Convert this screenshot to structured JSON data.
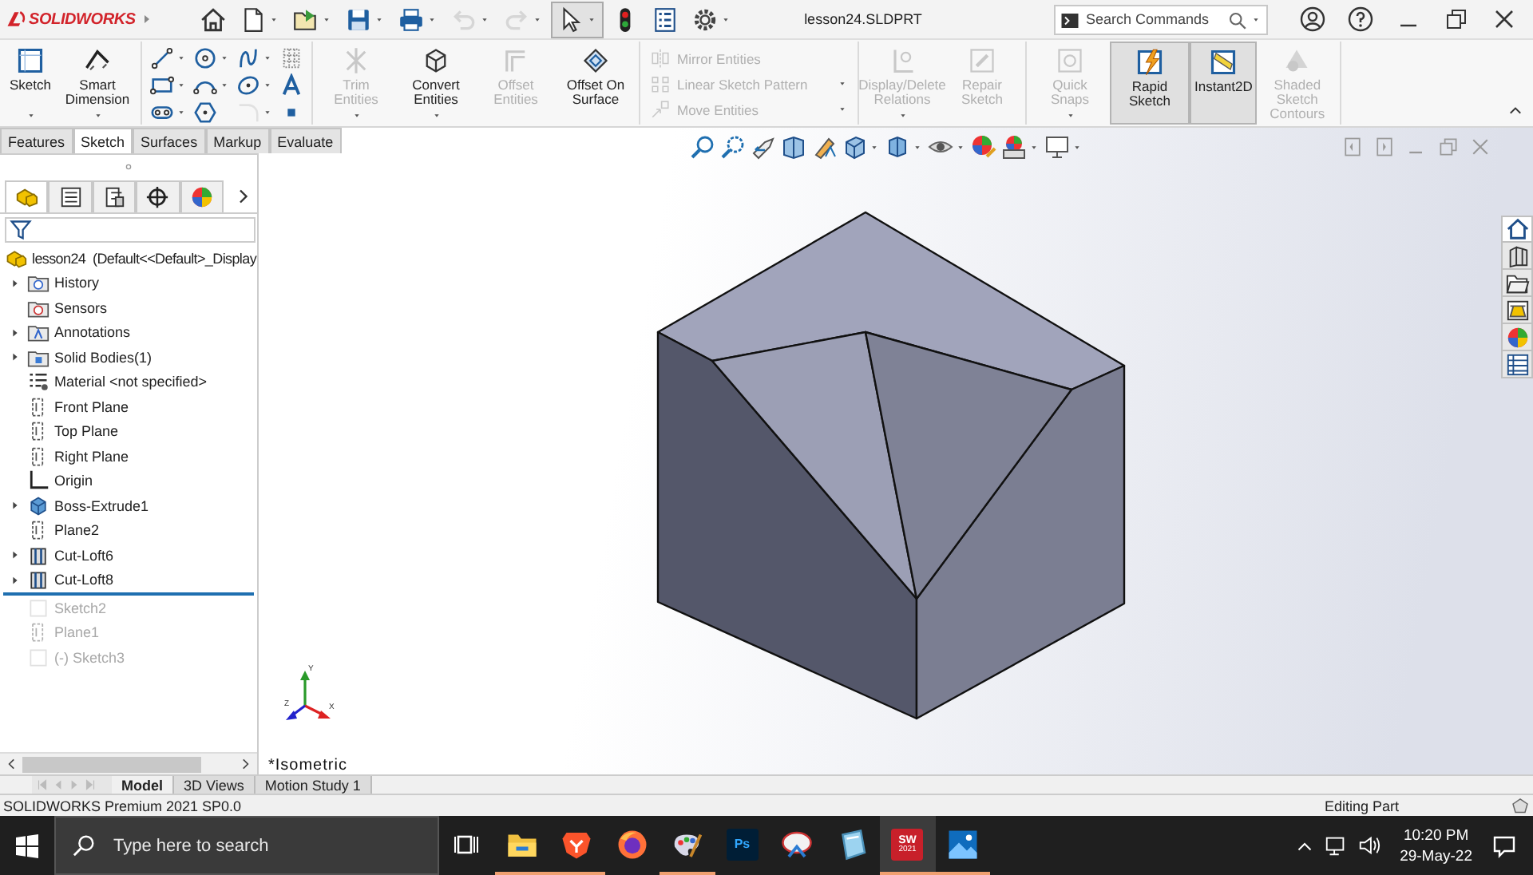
{
  "title_bar": {
    "logo": "SOLIDWORKS",
    "document_title": "lesson24.SLDPRT",
    "search": {
      "placeholder": "Search Commands"
    },
    "quick_access": [
      {
        "kind": "home",
        "dropdown": false,
        "disabled": false,
        "selected": false
      },
      {
        "kind": "new",
        "dropdown": true,
        "disabled": false,
        "selected": false
      },
      {
        "kind": "open",
        "dropdown": true,
        "disabled": false,
        "selected": false
      },
      {
        "kind": "save",
        "dropdown": true,
        "disabled": false,
        "selected": false
      },
      {
        "kind": "print",
        "dropdown": true,
        "disabled": false,
        "selected": false
      },
      {
        "kind": "undo",
        "dropdown": true,
        "disabled": true,
        "selected": false
      },
      {
        "kind": "redo",
        "dropdown": true,
        "disabled": true,
        "selected": false
      },
      {
        "kind": "select",
        "dropdown": true,
        "disabled": false,
        "selected": true
      },
      {
        "kind": "rebuild",
        "dropdown": false,
        "disabled": false,
        "selected": false
      },
      {
        "kind": "properties",
        "dropdown": false,
        "disabled": false,
        "selected": false
      },
      {
        "kind": "options",
        "dropdown": true,
        "disabled": false,
        "selected": false
      }
    ]
  },
  "ribbon": {
    "groups": [
      {
        "kind": "large",
        "tools": [
          {
            "kind": "sketch",
            "label": "Sketch",
            "disabled": false,
            "selected": false,
            "dropdown": true
          },
          {
            "kind": "smart_dimension",
            "label": "Smart Dimension",
            "disabled": false,
            "selected": false,
            "dropdown": true
          }
        ]
      },
      {
        "kind": "grid",
        "tools": [
          {
            "kind": "line",
            "dropdown": true,
            "disabled": false
          },
          {
            "kind": "circle",
            "dropdown": true,
            "disabled": false
          },
          {
            "kind": "spline",
            "dropdown": true,
            "disabled": false
          },
          {
            "kind": "grid_plane",
            "dropdown": false,
            "disabled": false
          },
          {
            "kind": "rectangle",
            "dropdown": true,
            "disabled": false
          },
          {
            "kind": "arc",
            "dropdown": true,
            "disabled": false
          },
          {
            "kind": "ellipse",
            "dropdown": true,
            "disabled": false
          },
          {
            "kind": "text",
            "dropdown": false,
            "disabled": false
          },
          {
            "kind": "slot",
            "dropdown": true,
            "disabled": false
          },
          {
            "kind": "polygon",
            "dropdown": false,
            "disabled": false
          },
          {
            "kind": "fillet",
            "dropdown": true,
            "disabled": true
          },
          {
            "kind": "point",
            "dropdown": false,
            "disabled": false
          }
        ]
      },
      {
        "kind": "large",
        "tools": [
          {
            "kind": "trim",
            "label": "Trim Entities",
            "disabled": true,
            "selected": false,
            "dropdown": true
          },
          {
            "kind": "convert",
            "label": "Convert Entities",
            "disabled": false,
            "selected": false,
            "dropdown": true
          },
          {
            "kind": "offset",
            "label": "Offset Entities",
            "disabled": true,
            "selected": false,
            "dropdown": false
          },
          {
            "kind": "offset_surface",
            "label": "Offset On Surface",
            "disabled": false,
            "selected": false,
            "dropdown": false
          }
        ]
      },
      {
        "kind": "stack",
        "tools": [
          {
            "kind": "mirror",
            "label": "Mirror Entities",
            "disabled": true,
            "dropdown": false
          },
          {
            "kind": "pattern",
            "label": "Linear Sketch Pattern",
            "disabled": true,
            "dropdown": true
          },
          {
            "kind": "move",
            "label": "Move Entities",
            "disabled": true,
            "dropdown": true
          }
        ]
      },
      {
        "kind": "large",
        "tools": [
          {
            "kind": "relations",
            "label": "Display/Delete Relations",
            "disabled": true,
            "selected": false,
            "dropdown": true
          },
          {
            "kind": "repair",
            "label": "Repair Sketch",
            "disabled": true,
            "selected": false,
            "dropdown": false
          }
        ]
      },
      {
        "kind": "large",
        "tools": [
          {
            "kind": "snaps",
            "label": "Quick Snaps",
            "disabled": true,
            "selected": false,
            "dropdown": true
          },
          {
            "kind": "rapid",
            "label": "Rapid Sketch",
            "disabled": false,
            "selected": true,
            "dropdown": false
          },
          {
            "kind": "instant2d",
            "label": "Instant2D",
            "disabled": false,
            "selected": true,
            "dropdown": false
          },
          {
            "kind": "shaded",
            "label": "Shaded Sketch Contours",
            "disabled": true,
            "selected": false,
            "dropdown": false
          }
        ]
      }
    ]
  },
  "command_tabs": [
    {
      "label": "Features",
      "selected": false
    },
    {
      "label": "Sketch",
      "selected": true
    },
    {
      "label": "Surfaces",
      "selected": false
    },
    {
      "label": "Markup",
      "selected": false
    },
    {
      "label": "Evaluate",
      "selected": false
    }
  ],
  "feature_manager": {
    "panel_tabs": [
      {
        "kind": "feature_tree",
        "selected": true
      },
      {
        "kind": "property",
        "selected": false
      },
      {
        "kind": "configuration",
        "selected": false
      },
      {
        "kind": "dimxpert",
        "selected": false
      },
      {
        "kind": "display",
        "selected": false
      }
    ],
    "root": "lesson24  (Default<<Default>_Display",
    "items": [
      {
        "label": "History",
        "kind": "history",
        "expandable": true,
        "rolled_back": false
      },
      {
        "label": "Sensors",
        "kind": "sensors",
        "expandable": false,
        "rolled_back": false
      },
      {
        "label": "Annotations",
        "kind": "annotations",
        "expandable": true,
        "rolled_back": false
      },
      {
        "label": "Solid Bodies(1)",
        "kind": "bodies",
        "expandable": true,
        "rolled_back": false
      },
      {
        "label": "Material <not specified>",
        "kind": "material",
        "expandable": false,
        "rolled_back": false
      },
      {
        "label": "Front Plane",
        "kind": "plane",
        "expandable": false,
        "rolled_back": false
      },
      {
        "label": "Top Plane",
        "kind": "plane",
        "expandable": false,
        "rolled_back": false
      },
      {
        "label": "Right Plane",
        "kind": "plane",
        "expandable": false,
        "rolled_back": false
      },
      {
        "label": "Origin",
        "kind": "origin",
        "expandable": false,
        "rolled_back": false
      },
      {
        "label": "Boss-Extrude1",
        "kind": "boss",
        "expandable": true,
        "rolled_back": false
      },
      {
        "label": "Plane2",
        "kind": "plane",
        "expandable": false,
        "rolled_back": false
      },
      {
        "label": "Cut-Loft6",
        "kind": "cut",
        "expandable": true,
        "rolled_back": false
      },
      {
        "label": "Cut-Loft8",
        "kind": "cut",
        "expandable": true,
        "rolled_back": false
      },
      {
        "label": "Sketch2",
        "kind": "sketch",
        "expandable": false,
        "rolled_back": true
      },
      {
        "label": "Plane1",
        "kind": "plane",
        "expandable": false,
        "rolled_back": true
      },
      {
        "label": "(-) Sketch3",
        "kind": "sketch",
        "expandable": false,
        "rolled_back": true
      }
    ]
  },
  "viewport": {
    "view_name": "*Isometric",
    "triad": [
      "Y",
      "X",
      "Z"
    ]
  },
  "task_pane": [
    {
      "kind": "home",
      "selected": true
    },
    {
      "kind": "library",
      "selected": false
    },
    {
      "kind": "explorer",
      "selected": false
    },
    {
      "kind": "palette",
      "selected": false
    },
    {
      "kind": "appearance",
      "selected": false
    },
    {
      "kind": "properties",
      "selected": false
    }
  ],
  "bottom_tabs": [
    {
      "label": "Model",
      "selected": true
    },
    {
      "label": "3D Views",
      "selected": false
    },
    {
      "label": "Motion Study 1",
      "selected": false
    }
  ],
  "status_bar": {
    "product": "SOLIDWORKS Premium 2021 SP0.0",
    "mode": "Editing Part"
  },
  "taskbar": {
    "search": {
      "placeholder": "Type here to search"
    },
    "apps": [
      {
        "kind": "explorer",
        "running": true,
        "active": false
      },
      {
        "kind": "brave",
        "running": true,
        "active": false
      },
      {
        "kind": "firefox",
        "running": false,
        "active": false
      },
      {
        "kind": "paint",
        "running": true,
        "active": false
      },
      {
        "kind": "photoshop",
        "label": "Ps",
        "running": false,
        "active": false
      },
      {
        "kind": "snip",
        "running": false,
        "active": false
      },
      {
        "kind": "notes",
        "running": false,
        "active": false
      },
      {
        "kind": "solidworks",
        "label": "SW",
        "sublabel": "2021",
        "running": true,
        "active": true
      },
      {
        "kind": "photos",
        "running": true,
        "active": false
      }
    ],
    "clock": {
      "time": "10:20 PM",
      "date": "29-May-22"
    }
  }
}
